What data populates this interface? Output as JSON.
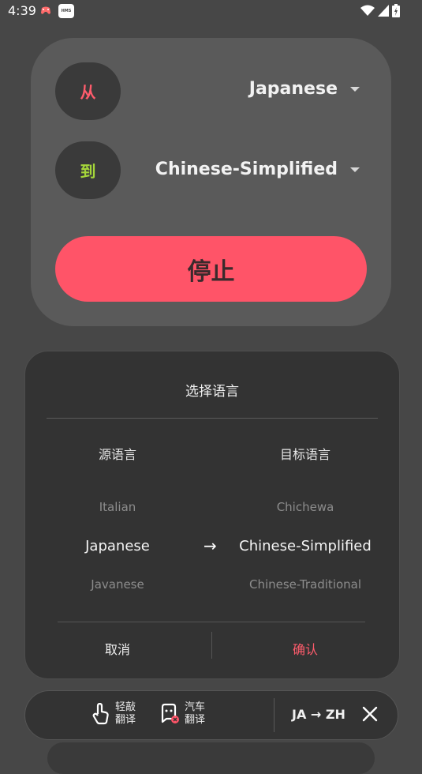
{
  "status_bar": {
    "time": "4:39",
    "app_badge": "HMS"
  },
  "top_card": {
    "from_label": "从",
    "from_language": "Japanese",
    "to_label": "到",
    "to_language": "Chinese-Simplified",
    "stop_label": "停止"
  },
  "dialog": {
    "title": "选择语言",
    "source_header": "源语言",
    "target_header": "目标语言",
    "source_picker": [
      "Italian",
      "Japanese",
      "Javanese"
    ],
    "target_picker": [
      "Chichewa",
      "Chinese-Simplified",
      "Chinese-Traditional"
    ],
    "arrow": "→",
    "cancel_label": "取消",
    "confirm_label": "确认"
  },
  "toolbar": {
    "tap_translate_line1": "轻敲",
    "tap_translate_line2": "翻译",
    "car_translate_line1": "汽车",
    "car_translate_line2": "翻译",
    "lang_pair": "JA → ZH"
  },
  "colors": {
    "accent_red": "#ff5468",
    "accent_green": "#a5d63a",
    "background": "#474747"
  }
}
